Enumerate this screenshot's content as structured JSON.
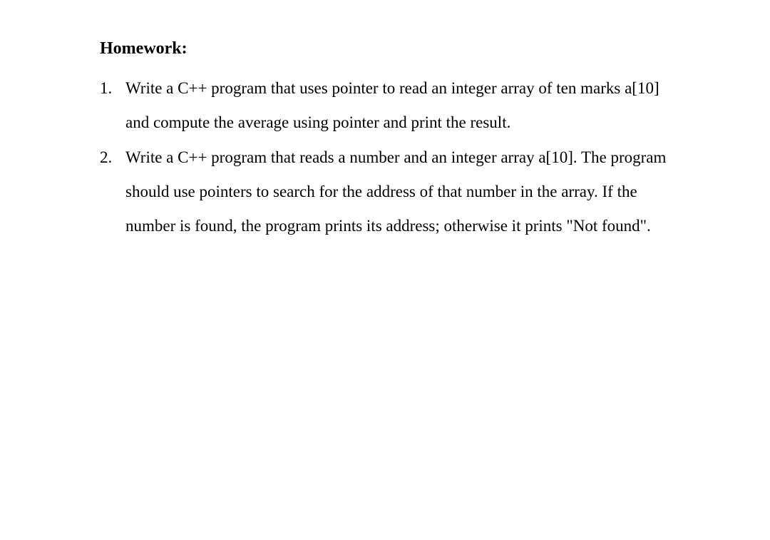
{
  "heading": "Homework:",
  "items": [
    "Write a C++ program that uses pointer to read an integer array of ten marks a[10] and compute the average using pointer and print the result.",
    "Write a C++ program that reads a number and an integer array a[10]. The program should use pointers to search for the address of that number in the array. If the number is found, the program prints its address; otherwise it prints \"Not found\"."
  ]
}
